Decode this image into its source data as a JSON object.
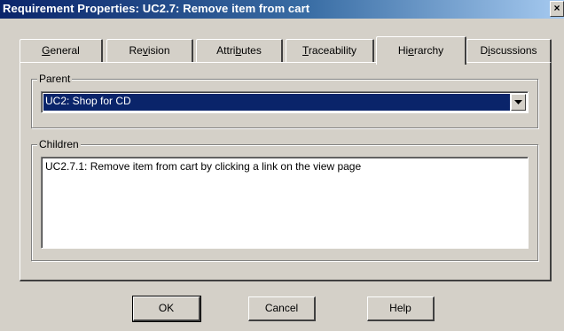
{
  "window": {
    "title": "Requirement Properties: UC2.7: Remove item from cart",
    "close_glyph": "×"
  },
  "tabs": [
    {
      "pre": "",
      "key": "G",
      "post": "eneral"
    },
    {
      "pre": "Re",
      "key": "v",
      "post": "ision"
    },
    {
      "pre": "Attri",
      "key": "b",
      "post": "utes"
    },
    {
      "pre": "",
      "key": "T",
      "post": "raceability"
    },
    {
      "pre": "Hi",
      "key": "e",
      "post": "rarchy"
    },
    {
      "pre": "D",
      "key": "i",
      "post": "scussions"
    }
  ],
  "active_tab": "Hierarchy",
  "parent": {
    "label": "Parent",
    "value": "UC2: Shop for CD"
  },
  "children": {
    "label": "Children",
    "items": [
      "UC2.7.1: Remove item from cart by clicking a link on the view page"
    ]
  },
  "buttons": {
    "ok": "OK",
    "cancel": "Cancel",
    "help": "Help"
  }
}
